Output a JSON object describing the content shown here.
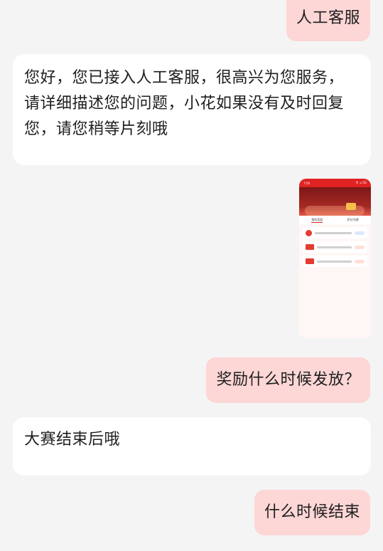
{
  "messages": {
    "m1": "人工客服",
    "m2": "您好，您已接入人工客服，很高兴为您服务，请详细描述您的问题，小花如果没有及时回复您，请您稍等片刻哦",
    "m4": "奖励什么时候发放？",
    "m5": "大赛结束后哦",
    "m6": "什么时候结束"
  },
  "thumbnail": {
    "status_time": "7:56",
    "status_icons": "令 ⊿ 5G",
    "tab_1": "我的奖励",
    "tab_2": "积分兑换"
  },
  "colors": {
    "user_bubble": "#fdd6d6",
    "agent_bubble": "#ffffff",
    "background": "#f4f4f4",
    "accent_red": "#e02222"
  }
}
